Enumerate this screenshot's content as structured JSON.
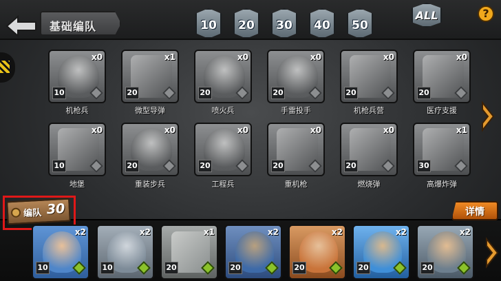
{
  "header": {
    "title": "基础编队",
    "level_filters": [
      "10",
      "20",
      "30",
      "40",
      "50"
    ],
    "all_label": "ALL",
    "help_label": "?"
  },
  "units": [
    {
      "name": "机枪兵",
      "level": "10",
      "count": "x0",
      "icon": "soldier-helmet-icon"
    },
    {
      "name": "微型导弹",
      "level": "20",
      "count": "x1",
      "icon": "missile-launcher-icon"
    },
    {
      "name": "喷火兵",
      "level": "20",
      "count": "x0",
      "icon": "gasmask-soldier-icon"
    },
    {
      "name": "手雷投手",
      "level": "20",
      "count": "x0",
      "icon": "grenadier-icon"
    },
    {
      "name": "机枪兵营",
      "level": "20",
      "count": "x0",
      "icon": "barracks-icon"
    },
    {
      "name": "医疗支援",
      "level": "20",
      "count": "x0",
      "icon": "ambulance-icon"
    },
    {
      "name": "地堡",
      "level": "10",
      "count": "x0",
      "icon": "bunker-icon"
    },
    {
      "name": "重装步兵",
      "level": "20",
      "count": "x0",
      "icon": "heavy-infantry-icon"
    },
    {
      "name": "工程兵",
      "level": "20",
      "count": "x0",
      "icon": "engineer-icon"
    },
    {
      "name": "重机枪",
      "level": "20",
      "count": "x0",
      "icon": "heavy-machinegun-icon"
    },
    {
      "name": "燃烧弹",
      "level": "20",
      "count": "x0",
      "icon": "incendiary-bomb-icon"
    },
    {
      "name": "高爆炸弹",
      "level": "30",
      "count": "x1",
      "icon": "high-explosive-bomb-icon"
    }
  ],
  "squad": {
    "label": "编队",
    "capacity": "30",
    "detail_label": "详情",
    "members": [
      {
        "level": "10",
        "count": "x2",
        "icon": "soldier-helmet-icon",
        "color": "#4f86c9"
      },
      {
        "level": "10",
        "count": "x2",
        "icon": "bunker-icon",
        "color": "#7d8b98"
      },
      {
        "level": "20",
        "count": "x1",
        "icon": "missile-launcher-icon",
        "color": "#8a8f8f"
      },
      {
        "level": "20",
        "count": "x2",
        "icon": "heavy-infantry-icon",
        "color": "#3d6aa8"
      },
      {
        "level": "20",
        "count": "x2",
        "icon": "gasmask-soldier-icon",
        "color": "#c9743a"
      },
      {
        "level": "20",
        "count": "x2",
        "icon": "engineer-icon",
        "color": "#3f8fd8"
      },
      {
        "level": "20",
        "count": "x2",
        "icon": "grenadier-icon",
        "color": "#6d7f8e"
      }
    ]
  },
  "colors": {
    "accent": "#f08a24",
    "highlight": "#e01818",
    "rank_green": "#8bc22a"
  }
}
